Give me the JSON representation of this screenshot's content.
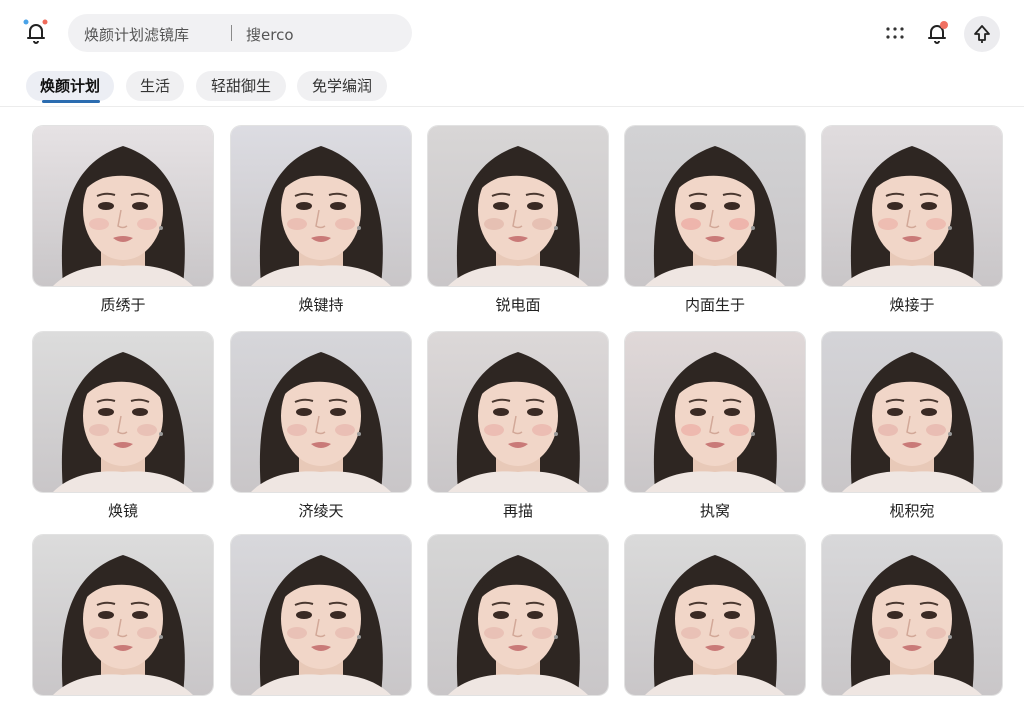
{
  "header": {
    "search_text": "焕颜计划滤镜库",
    "search_hint": "搜erco",
    "logo_icon": "bell-sparkle-icon",
    "grid_icon": "dots-grid-icon",
    "notif_icon": "bell-icon",
    "upload_icon": "upload-icon"
  },
  "tabs": [
    {
      "label": "焕颜计划"
    },
    {
      "label": "生活"
    },
    {
      "label": "轻甜御生"
    },
    {
      "label": "免学编润"
    }
  ],
  "filters": [
    {
      "label": "质绣于",
      "bg": "#e6e2e4",
      "blush": "#e8a8a2"
    },
    {
      "label": "焕键持",
      "bg": "#dcdce2",
      "blush": "#e4a49c"
    },
    {
      "label": "锐电面",
      "bg": "#d8d6d6",
      "blush": "#d9a69a"
    },
    {
      "label": "内面生于",
      "bg": "#d2d2d4",
      "blush": "#ec8f8a"
    },
    {
      "label": "焕接于",
      "bg": "#e0dcde",
      "blush": "#eaa096"
    },
    {
      "label": "焕镜",
      "bg": "#dcdcdc",
      "blush": "#dfa8a0"
    },
    {
      "label": "济绫天",
      "bg": "#d6d6da",
      "blush": "#e2a49e"
    },
    {
      "label": "再描",
      "bg": "#dcd8d8",
      "blush": "#e6a09a"
    },
    {
      "label": "执窝",
      "bg": "#e0d8d8",
      "blush": "#ec9690"
    },
    {
      "label": "枧积宛",
      "bg": "#d4d4d8",
      "blush": "#e0a098"
    },
    {
      "label": "",
      "bg": "#dcdcdc",
      "blush": "#e0a8a0"
    },
    {
      "label": "",
      "bg": "#d8d8dc",
      "blush": "#e0a8a0"
    },
    {
      "label": "",
      "bg": "#d6d6d6",
      "blush": "#e0a8a0"
    },
    {
      "label": "",
      "bg": "#dadada",
      "blush": "#e0a8a0"
    },
    {
      "label": "",
      "bg": "#d8d8da",
      "blush": "#e0a8a0"
    }
  ]
}
